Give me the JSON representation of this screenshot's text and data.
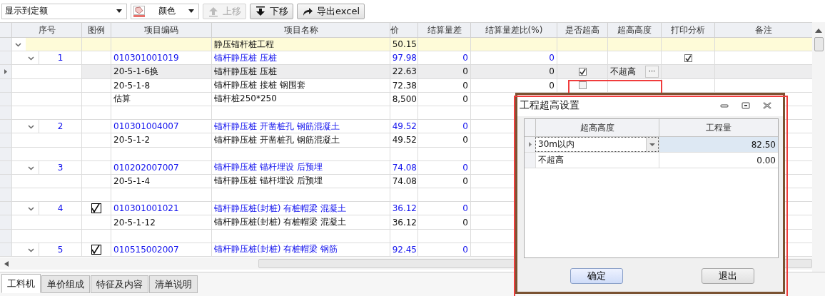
{
  "toolbar": {
    "view_dropdown": "显示到定额",
    "color_dropdown": "颜色",
    "buttons": [
      {
        "label": "上移",
        "kind": "up",
        "disabled": true
      },
      {
        "label": "下移",
        "kind": "down",
        "disabled": false
      },
      {
        "label": "导出excel",
        "kind": "export",
        "disabled": false
      }
    ]
  },
  "table": {
    "columns": [
      "序号",
      "图例",
      "项目编码",
      "项目名称",
      "价",
      "结算量差",
      "结算量差比(%)",
      "是否超高",
      "超高高度",
      "打印分析",
      "备注"
    ],
    "rows": [
      {
        "kind": "project",
        "selected": false,
        "expanded": true,
        "name": "静压锚杆桩工程",
        "price": "50.15"
      },
      {
        "kind": "item",
        "selected": false,
        "expanded": true,
        "seq": "1",
        "legend": false,
        "code": "010301001019",
        "name": "锚杆静压桩 压桩",
        "price": "97.98",
        "diff": "0",
        "diff_pct": "0",
        "print_analysis": true
      },
      {
        "kind": "sub",
        "selected": true,
        "code": "20-5-1-6换",
        "name": "锚杆静压桩 压桩",
        "price": "22.63",
        "diff": "0",
        "diff_pct": "0",
        "over_height_flag": true,
        "over_height": "不超高",
        "more": "···"
      },
      {
        "kind": "sub",
        "selected": false,
        "code": "20-5-1-8",
        "name": "锚杆静压桩 接桩 钢围套",
        "price": "72.38",
        "diff": "0",
        "diff_pct": "0",
        "over_height_flag": false
      },
      {
        "kind": "sub",
        "selected": false,
        "code": "估算",
        "name": "锚杆桩250*250",
        "price": "8,500",
        "diff": "0"
      },
      {
        "kind": "blank",
        "selected": false
      },
      {
        "kind": "item",
        "selected": false,
        "expanded": true,
        "seq": "2",
        "legend": false,
        "code": "010301004007",
        "name": "锚杆静压桩 开凿桩孔 钢筋混凝土",
        "price": "49.52",
        "diff": "0"
      },
      {
        "kind": "sub",
        "selected": false,
        "code": "20-5-1-2",
        "name": "锚杆静压桩 开凿桩孔 钢筋混凝土",
        "price": "49.52",
        "diff": "0"
      },
      {
        "kind": "blank",
        "selected": false
      },
      {
        "kind": "item",
        "selected": false,
        "expanded": true,
        "seq": "3",
        "legend": false,
        "code": "010202007007",
        "name": "锚杆静压桩 锚杆埋设 后预埋",
        "price": "74.08",
        "diff": "0"
      },
      {
        "kind": "sub",
        "selected": false,
        "code": "20-5-1-4",
        "name": "锚杆静压桩 锚杆埋设 后预埋",
        "price": "74.08",
        "diff": "0"
      },
      {
        "kind": "blank",
        "selected": false
      },
      {
        "kind": "item",
        "selected": false,
        "expanded": true,
        "seq": "4",
        "legend": true,
        "code": "010301001021",
        "name": "锚杆静压桩(封桩) 有桩帽梁 混凝土",
        "price": "36.12",
        "diff": "0"
      },
      {
        "kind": "sub",
        "selected": false,
        "code": "20-5-1-12",
        "name": "锚杆静压桩(封桩) 有桩帽梁 混凝土",
        "price": "36.12",
        "diff": "0"
      },
      {
        "kind": "blank",
        "selected": false
      },
      {
        "kind": "item",
        "selected": false,
        "expanded": true,
        "seq": "5",
        "legend": true,
        "code": "010515002007",
        "name": "锚杆静压桩(封桩) 有桩帽梁 钢筋",
        "price": "92.45",
        "diff": "0"
      }
    ]
  },
  "bottom_tabs": [
    {
      "label": "工料机",
      "selected": true
    },
    {
      "label": "单价组成",
      "selected": false
    },
    {
      "label": "特征及内容",
      "selected": false
    },
    {
      "label": "清单说明",
      "selected": false
    }
  ],
  "dialog": {
    "title": "工程超高设置",
    "columns": [
      "超高高度",
      "工程量"
    ],
    "rows": [
      {
        "height": "30m以内",
        "quantity": "82.50",
        "selected": true
      },
      {
        "height": "不超高",
        "quantity": "0.00",
        "selected": false
      }
    ],
    "buttons": [
      {
        "label": "确定",
        "kind": "default"
      },
      {
        "label": "退出",
        "kind": "normal"
      }
    ]
  }
}
